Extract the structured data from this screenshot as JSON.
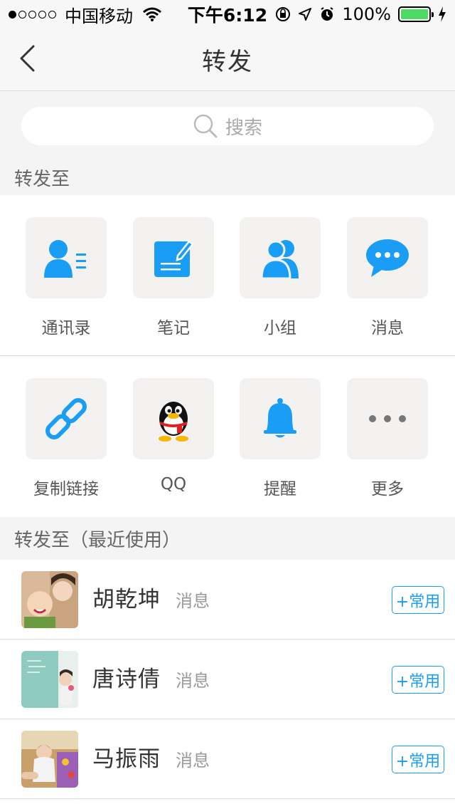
{
  "status_bar": {
    "carrier": "中国移动",
    "time": "下午6:12",
    "battery": "100%",
    "signal_bars_filled": 1,
    "signal_bars_total": 5
  },
  "nav": {
    "title": "转发",
    "back_icon": "chevron-left-icon"
  },
  "search": {
    "placeholder": "搜索",
    "icon": "search-icon"
  },
  "share_section": {
    "label": "转发至",
    "items": [
      {
        "label": "通讯录",
        "icon": "contacts-icon"
      },
      {
        "label": "笔记",
        "icon": "note-icon"
      },
      {
        "label": "小组",
        "icon": "group-icon"
      },
      {
        "label": "消息",
        "icon": "message-icon"
      },
      {
        "label": "复制链接",
        "icon": "link-icon"
      },
      {
        "label": "QQ",
        "icon": "qq-penguin-icon"
      },
      {
        "label": "提醒",
        "icon": "bell-icon"
      },
      {
        "label": "更多",
        "icon": "more-icon"
      }
    ]
  },
  "recent_section": {
    "label": "转发至（最近使用）",
    "contacts": [
      {
        "name": "胡乾坤",
        "type": "消息",
        "action": "+常用"
      },
      {
        "name": "唐诗倩",
        "type": "消息",
        "action": "+常用"
      },
      {
        "name": "马振雨",
        "type": "消息",
        "action": "+常用"
      }
    ]
  },
  "colors": {
    "accent": "#1a9df5",
    "background": "#f4f4f4",
    "tile": "#f4f2f0"
  }
}
